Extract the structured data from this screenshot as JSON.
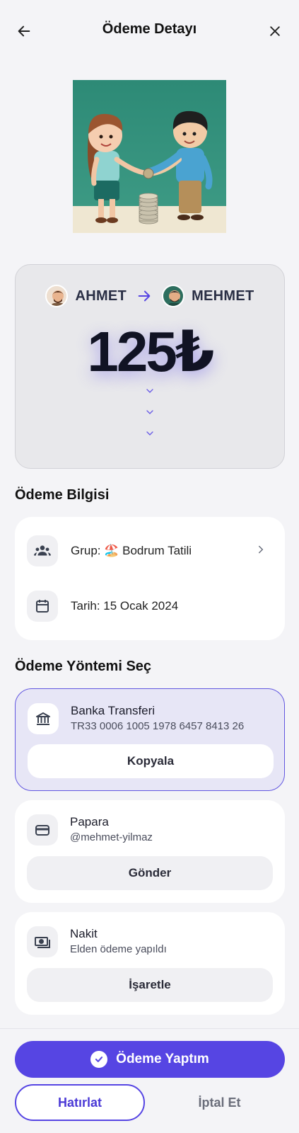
{
  "header": {
    "title": "Ödeme Detayı"
  },
  "transfer": {
    "from": "AHMET",
    "to": "MEHMET",
    "amount": "125₺"
  },
  "info_section": {
    "title": "Ödeme Bilgisi",
    "group": "Grup: 🏖️ Bodrum Tatili",
    "date": "Tarih: 15 Ocak 2024"
  },
  "methods_section": {
    "title": "Ödeme Yöntemi Seç",
    "methods": [
      {
        "name": "Banka Transferi",
        "detail": "TR33 0006 1005 1978 6457 8413 26",
        "action": "Kopyala",
        "icon": "bank-icon",
        "selected": true
      },
      {
        "name": "Papara",
        "detail": "@mehmet-yilmaz",
        "action": "Gönder",
        "icon": "wallet-icon",
        "selected": false
      },
      {
        "name": "Nakit",
        "detail": "Elden ödeme yapıldı",
        "action": "İşaretle",
        "icon": "cash-icon",
        "selected": false
      }
    ]
  },
  "footer": {
    "primary": "Ödeme Yaptım",
    "remind": "Hatırlat",
    "cancel": "İptal Et"
  },
  "colors": {
    "accent": "#5645e3",
    "selected_bg": "#e7e6f6",
    "background": "#f4f4f7"
  }
}
